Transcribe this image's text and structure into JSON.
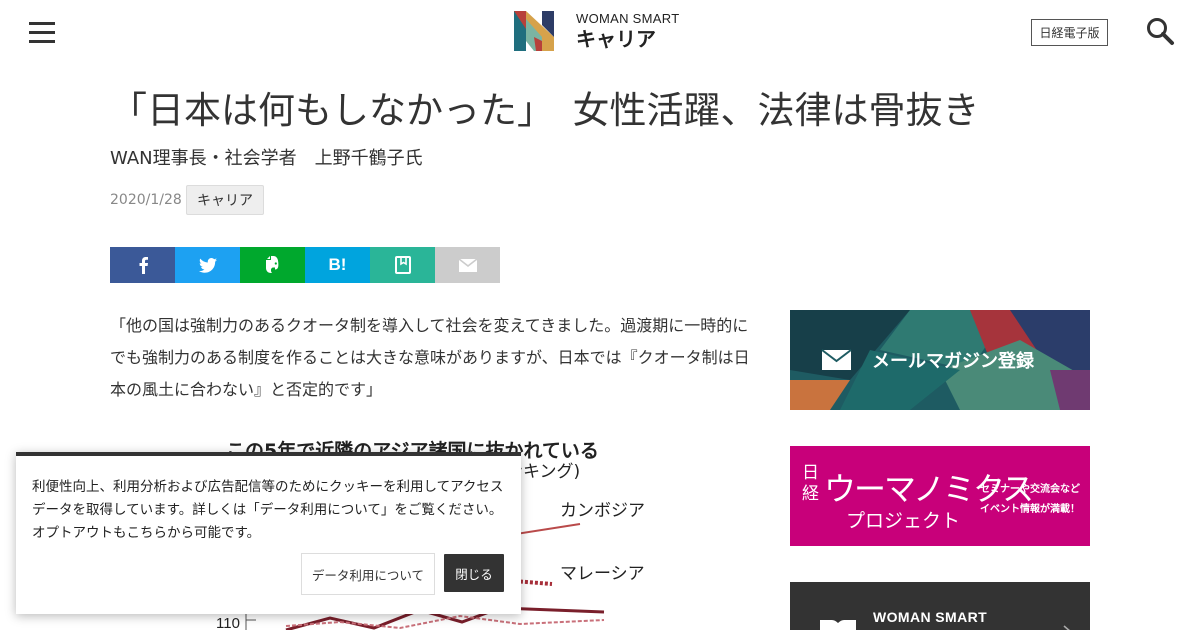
{
  "header": {
    "logo_line1": "WOMAN SMART",
    "logo_line2": "キャリア",
    "edition_button": "日経電子版"
  },
  "article": {
    "title": "「日本は何もしなかった」　女性活躍、法律は骨抜き",
    "byline": "WAN理事長・社会学者　上野千鶴子氏",
    "date": "2020/1/28",
    "tag": "キャリア",
    "quote": "「他の国は強制力のあるクオータ制を導入して社会を変えてきました。過渡期に一時的にでも強制力のある制度を作ることは大きな意味がありますが、日本では『クオータ制は日本の風土に合わない』と否定的です」"
  },
  "share": {
    "colors": {
      "facebook": "#3b5998",
      "twitter": "#1da1f2",
      "evernote": "#00a82d",
      "hatena": "#00a4de",
      "pocket": "#2ab598",
      "mail": "#cccccc"
    },
    "icons": [
      "facebook-icon",
      "twitter-icon",
      "evernote-icon",
      "hatena-bookmark-icon",
      "pocket-icon",
      "mail-icon"
    ],
    "hatena_label": "B!"
  },
  "chart_data": {
    "type": "line",
    "title": "この5年で近隣のアジア諸国に抜かれている",
    "subtitle": "ンキング)",
    "series": [
      {
        "name": "カンボジア"
      },
      {
        "name": "マレーシア"
      }
    ],
    "visible_y_tick": "110"
  },
  "sidebar": {
    "banners": [
      {
        "label": "メールマガジン登録",
        "icon": "envelope-icon"
      },
      {
        "label_main": "ウーマノミクス",
        "label_nikkei_top": "日",
        "label_nikkei_bottom": "経",
        "label_sub": "プロジェクト",
        "label_side_1": "セミナーや交流会など",
        "label_side_2": "イベント情報が満載！",
        "color": "#c8007a"
      },
      {
        "label": "WOMAN SMART",
        "color": "#333333",
        "icon": "book-icon"
      }
    ]
  },
  "cookie": {
    "text": "利便性向上、利用分析および広告配信等のためにクッキーを利用してアクセスデータを取得しています。詳しくは「データ利用について」をご覧ください。オプトアウトもこちらから可能です。",
    "data_button": "データ利用について",
    "close_button": "閉じる"
  }
}
